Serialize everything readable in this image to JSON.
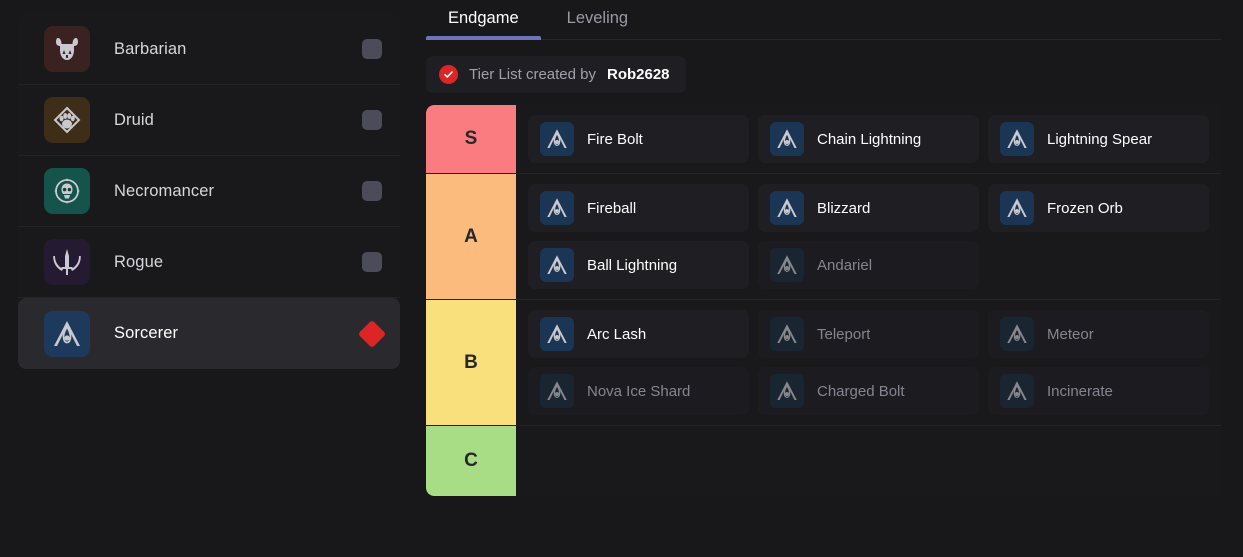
{
  "sidebar": {
    "classes": [
      {
        "name": "Barbarian",
        "icon": "barbarian-helm-icon",
        "icon_bg": "#3A2220",
        "marker": "box",
        "selected": false
      },
      {
        "name": "Druid",
        "icon": "druid-paw-icon",
        "icon_bg": "#3E2E18",
        "marker": "box",
        "selected": false
      },
      {
        "name": "Necromancer",
        "icon": "necromancer-skull-icon",
        "icon_bg": "#14544B",
        "marker": "box",
        "selected": false
      },
      {
        "name": "Rogue",
        "icon": "rogue-dagger-icon",
        "icon_bg": "#241B33",
        "marker": "box",
        "selected": false
      },
      {
        "name": "Sorcerer",
        "icon": "sorcerer-flame-icon",
        "icon_bg": "#1D3A5C",
        "marker": "diamond",
        "selected": true
      }
    ],
    "marker_colors": {
      "inactive": "#4B4B5A",
      "active": "#DC2626"
    }
  },
  "main": {
    "tabs": [
      {
        "label": "Endgame",
        "active": true
      },
      {
        "label": "Leveling",
        "active": false
      }
    ],
    "tab_accent": "#6B75B8",
    "credit": {
      "icon": "verified-check-icon",
      "icon_color": "#DC2626",
      "text": "Tier List created by",
      "author": "Rob2628"
    },
    "tiers": [
      {
        "label": "S",
        "color": "#FA7C81",
        "items": [
          {
            "name": "Fire Bolt",
            "dim": false
          },
          {
            "name": "Chain Lightning",
            "dim": false
          },
          {
            "name": "Lightning Spear",
            "dim": false
          }
        ]
      },
      {
        "label": "A",
        "color": "#FABB7C",
        "items": [
          {
            "name": "Fireball",
            "dim": false
          },
          {
            "name": "Blizzard",
            "dim": false
          },
          {
            "name": "Frozen Orb",
            "dim": false
          },
          {
            "name": "Ball Lightning",
            "dim": false
          },
          {
            "name": "Andariel",
            "dim": true
          }
        ]
      },
      {
        "label": "B",
        "color": "#FAE07C",
        "items": [
          {
            "name": "Arc Lash",
            "dim": false
          },
          {
            "name": "Teleport",
            "dim": true
          },
          {
            "name": "Meteor",
            "dim": true
          },
          {
            "name": "Nova Ice Shard",
            "dim": true
          },
          {
            "name": "Charged Bolt",
            "dim": true
          },
          {
            "name": "Incinerate",
            "dim": true
          }
        ]
      },
      {
        "label": "C",
        "color": "#A8DC85",
        "items": []
      }
    ]
  }
}
